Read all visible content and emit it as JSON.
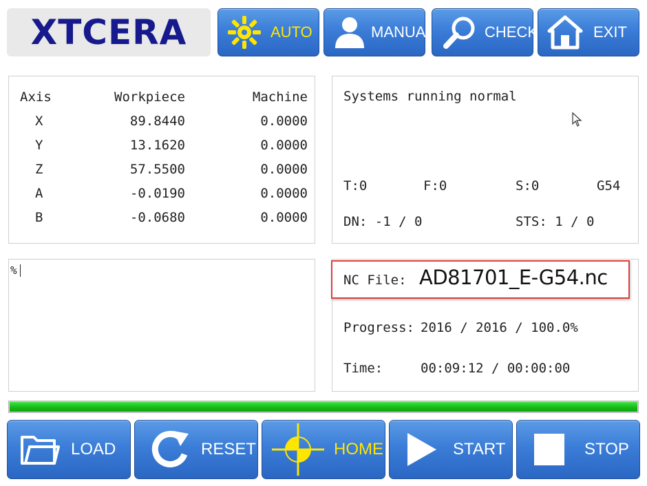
{
  "header": {
    "logo_text": "XTCERA",
    "buttons": [
      {
        "label": "AUTO",
        "icon": "gear-sun-icon",
        "active": true
      },
      {
        "label": "MANUAL",
        "icon": "user-icon"
      },
      {
        "label": "CHECK",
        "icon": "magnifier-icon"
      },
      {
        "label": "EXIT",
        "icon": "home-icon"
      }
    ]
  },
  "axes": {
    "headers": {
      "axis": "Axis",
      "workpiece": "Workpiece",
      "machine": "Machine"
    },
    "rows": [
      {
        "axis": "X",
        "workpiece": "89.8440",
        "machine": "0.0000"
      },
      {
        "axis": "Y",
        "workpiece": "13.1620",
        "machine": "0.0000"
      },
      {
        "axis": "Z",
        "workpiece": "57.5500",
        "machine": "0.0000"
      },
      {
        "axis": "A",
        "workpiece": "-0.0190",
        "machine": "0.0000"
      },
      {
        "axis": "B",
        "workpiece": "-0.0680",
        "machine": "0.0000"
      }
    ]
  },
  "status": {
    "message": "Systems running normal",
    "t": "T:0",
    "f": "F:0",
    "s": "S:0",
    "coord": "G54",
    "dn": "DN: -1 / 0",
    "sts": "STS: 1 / 0"
  },
  "editor": {
    "content": "%"
  },
  "file_info": {
    "nc_label": "NC File:",
    "nc_name": "AD81701_E-G54.nc",
    "progress_label": "Progress:",
    "progress_value": "2016 / 2016 / 100.0%",
    "time_label": "Time:",
    "time_value": "00:09:12 / 00:00:00"
  },
  "progress": {
    "fraction": 1.0,
    "color": "#1ec81e"
  },
  "footer": {
    "buttons": [
      {
        "label": "LOAD",
        "icon": "folder-icon"
      },
      {
        "label": "RESET",
        "icon": "refresh-icon"
      },
      {
        "label": "HOME",
        "icon": "crosshair-icon"
      },
      {
        "label": "START",
        "icon": "play-icon"
      },
      {
        "label": "STOP",
        "icon": "stop-icon"
      }
    ]
  },
  "colors": {
    "accent": "#3b7dd8",
    "highlight": "#ffe600",
    "axis_label": "#35c93a",
    "callout_border": "#e03c3c"
  }
}
